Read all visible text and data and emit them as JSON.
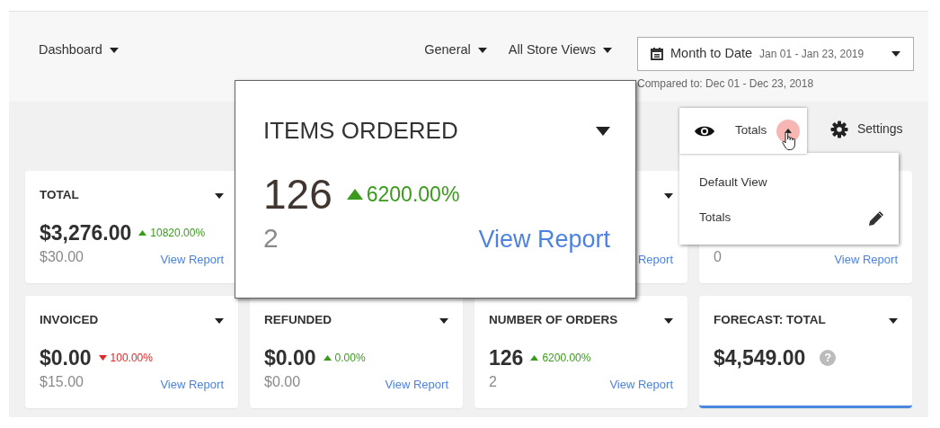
{
  "header": {
    "title": "Dashboard",
    "scope": "General",
    "store_view": "All Store Views",
    "date_range": {
      "label": "Month to Date",
      "range": "Jan 01 - Jan 23, 2019"
    },
    "compared": "Compared to: Dec 01 - Dec 23, 2018"
  },
  "view_switcher": {
    "label": "Totals",
    "expanded": true,
    "settings": "Settings",
    "menu": [
      {
        "label": "Default View",
        "editable": false
      },
      {
        "label": "Totals",
        "editable": true
      }
    ]
  },
  "cards": [
    {
      "title": "TOTAL",
      "value": "$3,276.00",
      "change": {
        "text": "10820.00%",
        "kind": "up"
      },
      "previous": "$30.00",
      "link": "View Report"
    },
    {
      "kind": "expanded",
      "title": "ITEMS ORDERED",
      "value": "126",
      "change": {
        "text": "6200.00%",
        "kind": "up"
      },
      "previous": "2",
      "link": "View Report"
    },
    {
      "link": "Report"
    },
    {
      "previous": "0",
      "link": "View Report"
    },
    {
      "title": "INVOICED",
      "value": "$0.00",
      "change": {
        "text": "100.00%",
        "kind": "down"
      },
      "previous": "$15.00",
      "link": "View Report"
    },
    {
      "title": "REFUNDED",
      "value": "$0.00",
      "change": {
        "text": "0.00%",
        "kind": "up"
      },
      "previous": "$0.00",
      "link": "View Report"
    },
    {
      "title": "NUMBER OF ORDERS",
      "value": "126",
      "change": {
        "text": "6200.00%",
        "kind": "up"
      },
      "previous": "2",
      "link": "View Report"
    },
    {
      "title": "FORECAST: TOTAL",
      "value": "$4,549.00",
      "highlighted": true,
      "help": "?"
    }
  ]
}
